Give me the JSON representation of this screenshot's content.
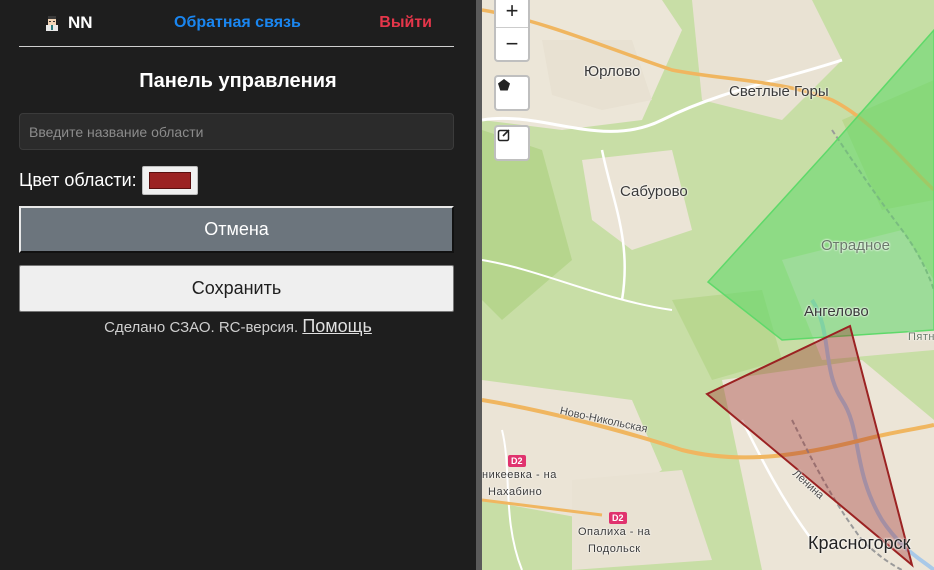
{
  "header": {
    "username": "NN",
    "avatar_icon": "user-avatar-icon",
    "feedback_label": "Обратная связь",
    "logout_label": "Выйти"
  },
  "panel": {
    "title": "Панель управления",
    "area_name_placeholder": "Введите название области",
    "area_name_value": "",
    "color_label": "Цвет области:",
    "selected_color": "#9b2222",
    "cancel_label": "Отмена",
    "save_label": "Сохранить",
    "footer_text": "Сделано СЗАО. RC-версия.",
    "help_label": "Помощь"
  },
  "map": {
    "zoom_in_label": "+",
    "zoom_out_label": "−",
    "draw_polygon_icon": "pentagon-icon",
    "edit_layers_icon": "edit-square-icon",
    "places": {
      "yurlovo": "Юрлово",
      "svetlye_gory": "Светлые Горы",
      "saburovo": "Сабурово",
      "otradnoe": "Отрадное",
      "angelovo": "Ангелово",
      "pyatn": "Пятн",
      "krasnogorsk": "Красногорск",
      "nikeevka_1": "никеевка - на",
      "nikeevka_2": "Нахабино",
      "opalikha_1": "Опалиха - на",
      "opalikha_2": "Подольск"
    },
    "roads": {
      "novo_nikolskaya": "Ново-Никольская",
      "lenina": "Ленина"
    },
    "route_badges": [
      "D2",
      "D2"
    ],
    "colors": {
      "green_polygon": "#5fd96a",
      "red_polygon": "#9b2222"
    }
  }
}
